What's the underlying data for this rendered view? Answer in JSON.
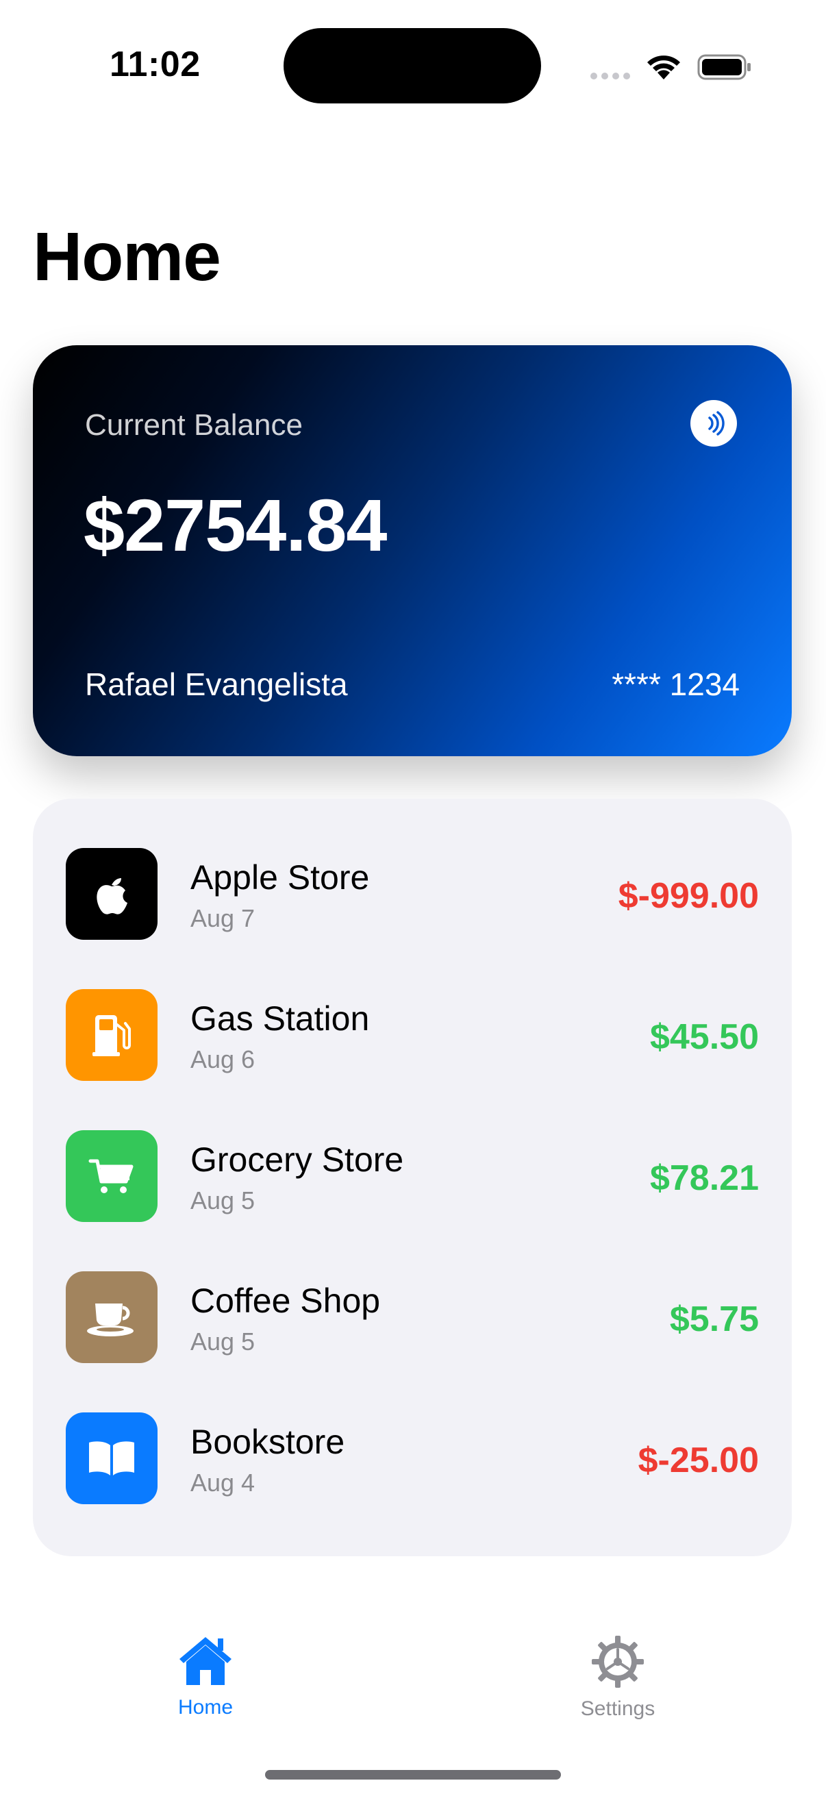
{
  "status_bar": {
    "time": "11:02"
  },
  "page": {
    "title": "Home"
  },
  "card": {
    "label": "Current Balance",
    "balance": "$2754.84",
    "holder": "Rafael Evangelista",
    "number": "**** 1234",
    "gradient_colors": [
      "#000000",
      "#0a7bff"
    ]
  },
  "transactions": [
    {
      "name": "Apple Store",
      "date": "Aug 7",
      "amount": "$-999.00",
      "icon": "apple-logo-icon",
      "icon_bg": "#000000",
      "amount_color": "#ee3b32"
    },
    {
      "name": "Gas Station",
      "date": "Aug 6",
      "amount": "$45.50",
      "icon": "fuel-pump-icon",
      "icon_bg": "#ff9500",
      "amount_color": "#34c759"
    },
    {
      "name": "Grocery Store",
      "date": "Aug 5",
      "amount": "$78.21",
      "icon": "shopping-cart-icon",
      "icon_bg": "#34c759",
      "amount_color": "#34c759"
    },
    {
      "name": "Coffee Shop",
      "date": "Aug 5",
      "amount": "$5.75",
      "icon": "coffee-cup-icon",
      "icon_bg": "#a2845e",
      "amount_color": "#34c759"
    },
    {
      "name": "Bookstore",
      "date": "Aug 4",
      "amount": "$-25.00",
      "icon": "book-icon",
      "icon_bg": "#0a7bff",
      "amount_color": "#ee3b32"
    }
  ],
  "tab_bar": {
    "home_label": "Home",
    "settings_label": "Settings",
    "active_color": "#0a7bff",
    "inactive_color": "#8e8e93"
  }
}
